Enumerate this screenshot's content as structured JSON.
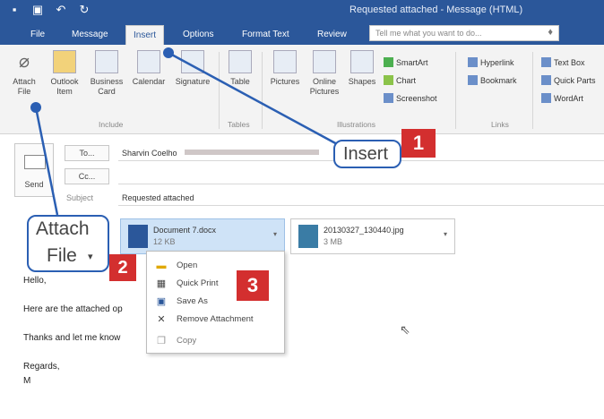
{
  "window": {
    "title": "Requested attached - Message (HTML)"
  },
  "tabs": [
    "File",
    "Message",
    "Insert",
    "Options",
    "Format Text",
    "Review"
  ],
  "tell_me": {
    "placeholder": "Tell me what you want to do..."
  },
  "ribbon": {
    "include": {
      "label": "Include",
      "attach_file": "Attach File",
      "outlook_item": "Outlook Item",
      "business_card": "Business Card",
      "calendar": "Calendar",
      "signature": "Signature"
    },
    "tables": {
      "label": "Tables",
      "table": "Table"
    },
    "illustrations": {
      "label": "Illustrations",
      "pictures": "Pictures",
      "online_pictures": "Online Pictures",
      "shapes": "Shapes",
      "smartart": "SmartArt",
      "chart": "Chart",
      "screenshot": "Screenshot"
    },
    "links": {
      "label": "Links",
      "hyperlink": "Hyperlink",
      "bookmark": "Bookmark"
    },
    "text": {
      "text_box": "Text Box",
      "quick_parts": "Quick Parts",
      "wordart": "WordArt"
    }
  },
  "header": {
    "send": "Send",
    "to_btn": "To...",
    "to_value": "Sharvin Coelho",
    "cc_btn": "Cc...",
    "subject_label": "Subject",
    "subject_value": "Requested attached"
  },
  "attachments": [
    {
      "name": "Document 7.docx",
      "size": "12 KB"
    },
    {
      "name": "20130327_130440.jpg",
      "size": "3 MB"
    }
  ],
  "body_lines": [
    "Hello,",
    "Here are the attached op",
    "Thanks and let me know",
    "Regards,",
    "M"
  ],
  "context_menu": [
    "Open",
    "Quick Print",
    "Save As",
    "Remove Attachment",
    "Copy"
  ],
  "callouts": {
    "insert": "Insert",
    "attach_line1": "Attach",
    "attach_line2": "File",
    "badge1": "1",
    "badge2": "2",
    "badge3": "3"
  },
  "colors": {
    "accent": "#2b579a",
    "callout_border": "#2b5fb3",
    "badge": "#d32f2f",
    "selected_attachment": "#cfe3f7"
  }
}
